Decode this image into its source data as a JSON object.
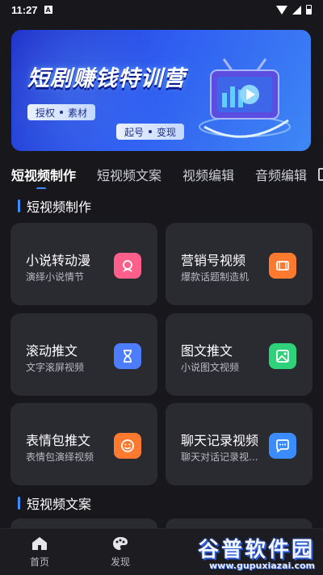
{
  "status_bar": {
    "time": "11:27",
    "a_badge": "A"
  },
  "banner": {
    "title": "短剧赚钱特训营",
    "tags_row1": [
      "授权",
      "素材"
    ],
    "tags_row2": [
      "起号",
      "变现"
    ]
  },
  "tabs": [
    {
      "label": "短视频制作",
      "active": true
    },
    {
      "label": "短视频文案",
      "active": false
    },
    {
      "label": "视频编辑",
      "active": false
    },
    {
      "label": "音频编辑",
      "active": false
    }
  ],
  "sections": [
    {
      "title": "短视频制作"
    },
    {
      "title": "短视频文案"
    }
  ],
  "cards": [
    {
      "title": "小说转动漫",
      "sub": "演绎小说情节",
      "icon": "anime-face-icon",
      "color": "#ff5f8a"
    },
    {
      "title": "营销号视频",
      "sub": "爆款话题制造机",
      "icon": "video-film-icon",
      "color": "#ff7a2e"
    },
    {
      "title": "滚动推文",
      "sub": "文字滚屏视频",
      "icon": "hourglass-icon",
      "color": "#4d7dff"
    },
    {
      "title": "图文推文",
      "sub": "小说图文视频",
      "icon": "image-icon",
      "color": "#2fd17a"
    },
    {
      "title": "表情包推文",
      "sub": "表情包演绎视频",
      "icon": "smile-face-icon",
      "color": "#ff7a2e"
    },
    {
      "title": "聊天记录视频",
      "sub": "聊天对话记录视...",
      "icon": "chat-bubble-icon",
      "color": "#3b8cff"
    }
  ],
  "bottom_nav": [
    {
      "label": "首页",
      "icon": "home-icon"
    },
    {
      "label": "发现",
      "icon": "palette-icon"
    }
  ],
  "watermark": {
    "main": "谷普软件园",
    "url": "www.gupuxiazai.com"
  }
}
